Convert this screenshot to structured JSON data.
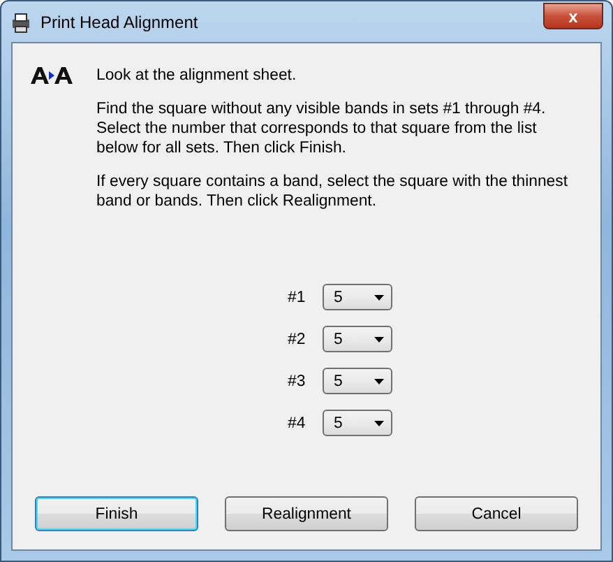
{
  "window": {
    "title": "Print Head Alignment",
    "close": "x"
  },
  "instructions": [
    "Look at the alignment sheet.",
    "Find the square without any visible bands in sets #1 through #4. Select the number that corresponds to that square from the list below for all sets. Then click Finish.",
    "If every square contains a band, select the square with the thinnest band or bands. Then click Realignment."
  ],
  "sets": [
    {
      "label": "#1",
      "value": "5"
    },
    {
      "label": "#2",
      "value": "5"
    },
    {
      "label": "#3",
      "value": "5"
    },
    {
      "label": "#4",
      "value": "5"
    }
  ],
  "buttons": [
    {
      "label": "Finish",
      "default": true
    },
    {
      "label": "Realignment",
      "default": false
    },
    {
      "label": "Cancel",
      "default": false
    }
  ]
}
